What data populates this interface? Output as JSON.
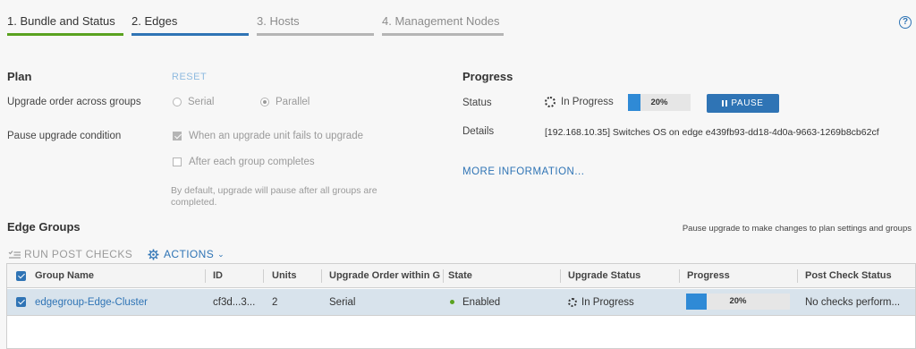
{
  "steps": [
    {
      "label": "1. Bundle and Status",
      "state": "done"
    },
    {
      "label": "2. Edges",
      "state": "active"
    },
    {
      "label": "3. Hosts",
      "state": "pending"
    },
    {
      "label": "4. Management Nodes",
      "state": "pending"
    }
  ],
  "help_glyph": "?",
  "plan": {
    "title": "Plan",
    "reset_label": "RESET",
    "upgrade_order_label": "Upgrade order across groups",
    "serial_label": "Serial",
    "parallel_label": "Parallel",
    "selected_order": "Parallel",
    "pause_condition_label": "Pause upgrade condition",
    "pause_on_fail_label": "When an upgrade unit fails to upgrade",
    "pause_on_fail_checked": true,
    "pause_each_group_label": "After each group completes",
    "pause_each_group_checked": false,
    "note": "By default, upgrade will pause after all groups are completed."
  },
  "progress": {
    "title": "Progress",
    "status_label": "Status",
    "status_value": "In Progress",
    "percent": 20,
    "percent_text": "20%",
    "pause_label": "PAUSE",
    "details_label": "Details",
    "details_value": "[192.168.10.35] Switches OS on edge e439fb93-dd18-4d0a-9663-1269b8cb62cf",
    "more_info_label": "MORE INFORMATION..."
  },
  "edge_groups": {
    "title": "Edge Groups",
    "hint": "Pause upgrade to make changes to plan settings and groups",
    "run_post_checks_label": "RUN POST CHECKS",
    "actions_label": "ACTIONS",
    "columns": [
      "Group Name",
      "ID",
      "Units",
      "Upgrade Order within G",
      "State",
      "Upgrade Status",
      "Progress",
      "Post Check Status"
    ],
    "rows": [
      {
        "group_name": "edgegroup-Edge-Cluster",
        "id": "cf3d...3...",
        "units": "2",
        "order": "Serial",
        "state": "Enabled",
        "upgrade_status": "In Progress",
        "progress": 20,
        "progress_text": "20%",
        "post_check": "No checks perform..."
      }
    ]
  },
  "colors": {
    "accent": "#2f74b5",
    "done": "#5aa220",
    "progress_fill": "#2f8ad6",
    "selected_row": "#d8e3ec"
  }
}
